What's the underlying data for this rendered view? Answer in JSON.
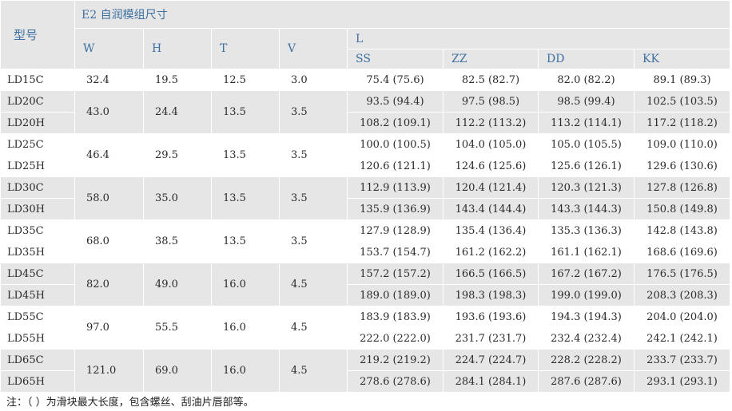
{
  "header": {
    "model_label": "型号",
    "group_label": "E2 自润模组尺寸",
    "columns": [
      "W",
      "H",
      "T",
      "V"
    ],
    "l_label": "L",
    "l_columns": [
      "SS",
      "ZZ",
      "DD",
      "KK"
    ]
  },
  "groups": [
    {
      "W": "32.4",
      "H": "19.5",
      "T": "12.5",
      "V": "3.0",
      "rows": [
        {
          "model": "LD15C",
          "L": [
            "75.4 (75.6)",
            "82.5 (82.7)",
            "82.0 (82.2)",
            "89.1 (89.3)"
          ]
        }
      ]
    },
    {
      "W": "43.0",
      "H": "24.4",
      "T": "13.5",
      "V": "3.5",
      "rows": [
        {
          "model": "LD20C",
          "L": [
            "93.5 (94.4)",
            "97.5 (98.5)",
            "98.5 (99.4)",
            "102.5 (103.5)"
          ]
        },
        {
          "model": "LD20H",
          "L": [
            "108.2 (109.1)",
            "112.2 (113.2)",
            "113.2 (114.1)",
            "117.2 (118.2)"
          ]
        }
      ]
    },
    {
      "W": "46.4",
      "H": "29.5",
      "T": "13.5",
      "V": "3.5",
      "rows": [
        {
          "model": "LD25C",
          "L": [
            "100.0 (100.5)",
            "104.0 (105.0)",
            "105.0 (105.5)",
            "109.0 (110.0)"
          ]
        },
        {
          "model": "LD25H",
          "L": [
            "120.6 (121.1)",
            "124.6 (125.6)",
            "125.6 (126.1)",
            "129.6 (130.6)"
          ]
        }
      ]
    },
    {
      "W": "58.0",
      "H": "35.0",
      "T": "13.5",
      "V": "3.5",
      "rows": [
        {
          "model": "LD30C",
          "L": [
            "112.9 (113.9)",
            "120.4 (121.4)",
            "120.3 (121.3)",
            "127.8 (126.8)"
          ]
        },
        {
          "model": "LD30H",
          "L": [
            "135.9 (136.9)",
            "143.4 (144.4)",
            "143.3 (144.3)",
            "150.8 (149.8)"
          ]
        }
      ]
    },
    {
      "W": "68.0",
      "H": "38.5",
      "T": "13.5",
      "V": "3.5",
      "rows": [
        {
          "model": "LD35C",
          "L": [
            "127.9 (128.9)",
            "135.4 (136.4)",
            "135.3 (136.3)",
            "142.8 (143.8)"
          ]
        },
        {
          "model": "LD35H",
          "L": [
            "153.7 (154.7)",
            "161.2 (162.2)",
            "161.1 (162.1)",
            "168.6 (169.6)"
          ]
        }
      ]
    },
    {
      "W": "82.0",
      "H": "49.0",
      "T": "16.0",
      "V": "4.5",
      "rows": [
        {
          "model": "LD45C",
          "L": [
            "157.2 (157.2)",
            "166.5 (166.5)",
            "167.2 (167.2)",
            "176.5 (176.5)"
          ]
        },
        {
          "model": "LD45H",
          "L": [
            "189.0 (189.0)",
            "198.3 (198.3)",
            "199.0 (199.0)",
            "208.3 (208.3)"
          ]
        }
      ]
    },
    {
      "W": "97.0",
      "H": "55.5",
      "T": "16.0",
      "V": "4.5",
      "rows": [
        {
          "model": "LD55C",
          "L": [
            "183.9 (183.9)",
            "193.6 (193.6)",
            "194.3 (194.3)",
            "204.0 (204.0)"
          ]
        },
        {
          "model": "LD55H",
          "L": [
            "222.0 (222.0)",
            "231.7 (231.7)",
            "232.4 (232.4)",
            "242.1 (242.1)"
          ]
        }
      ]
    },
    {
      "W": "121.0",
      "H": "69.0",
      "T": "16.0",
      "V": "4.5",
      "rows": [
        {
          "model": "LD65C",
          "L": [
            "219.2 (219.2)",
            "224.7 (224.7)",
            "228.2 (228.2)",
            "233.7 (233.7)"
          ]
        },
        {
          "model": "LD65H",
          "L": [
            "278.6 (278.6)",
            "284.1 (284.1)",
            "287.6 (287.6)",
            "293.1 (293.1)"
          ]
        }
      ]
    }
  ],
  "note": "注：（ ）为滑块最大长度，包含螺丝、刮油片唇部等。"
}
